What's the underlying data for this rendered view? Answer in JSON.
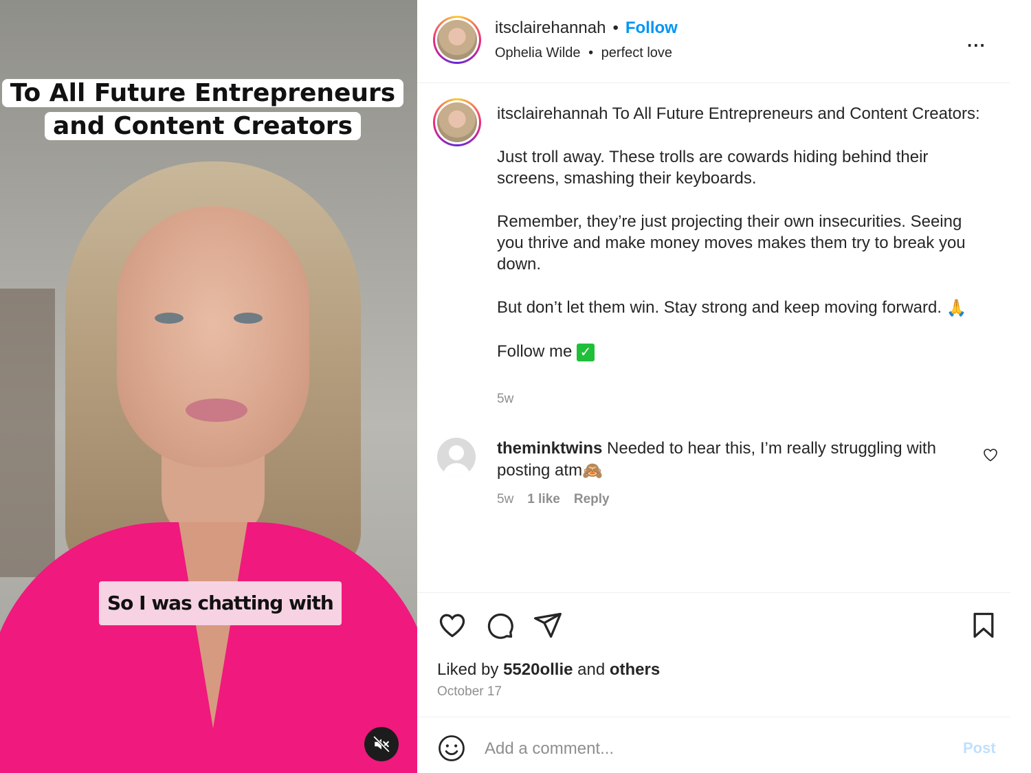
{
  "media": {
    "caption_top_line1": "To All Future Entrepreneurs",
    "caption_top_line2": "and Content Creators",
    "caption_bottom": "So I was chatting with",
    "mute_icon": "speaker-muted-icon"
  },
  "header": {
    "username": "itsclairehannah",
    "separator": "•",
    "follow_label": "Follow",
    "audio_artist": "Ophelia Wilde",
    "audio_separator": "•",
    "audio_track": "perfect love",
    "more_label": "..."
  },
  "caption": {
    "username": "itsclairehannah",
    "intro": "To All Future Entrepreneurs and Content Creators:",
    "para1": "Just troll away. These trolls are cowards hiding behind their screens, smashing their keyboards.",
    "para2": "Remember, they’re just projecting their own insecurities. Seeing you thrive and make money moves makes them try to break you down.",
    "para3": "But don’t let them win. Stay strong and keep moving forward.",
    "para3_emoji": "🙏",
    "para4": "Follow me",
    "para4_emoji": "✅",
    "time": "5w"
  },
  "comment": {
    "username": "theminktwins",
    "text": "Needed to hear this, I’m really struggling with posting atm",
    "emoji": "🙈",
    "time": "5w",
    "likes": "1 like",
    "reply_label": "Reply"
  },
  "actions": {
    "like_icon": "heart-icon",
    "comment_icon": "comment-icon",
    "share_icon": "send-icon",
    "save_icon": "bookmark-icon"
  },
  "likes": {
    "prefix": "Liked by",
    "user": "5520ollie",
    "middle": "and",
    "others": "others"
  },
  "date": "October 17",
  "add_comment": {
    "placeholder": "Add a comment...",
    "post_label": "Post"
  },
  "colors": {
    "link_blue": "#0095f6",
    "post_disabled": "#c0dffd",
    "muted_text": "#8e8e8e",
    "shirt_pink": "#f0197d"
  }
}
